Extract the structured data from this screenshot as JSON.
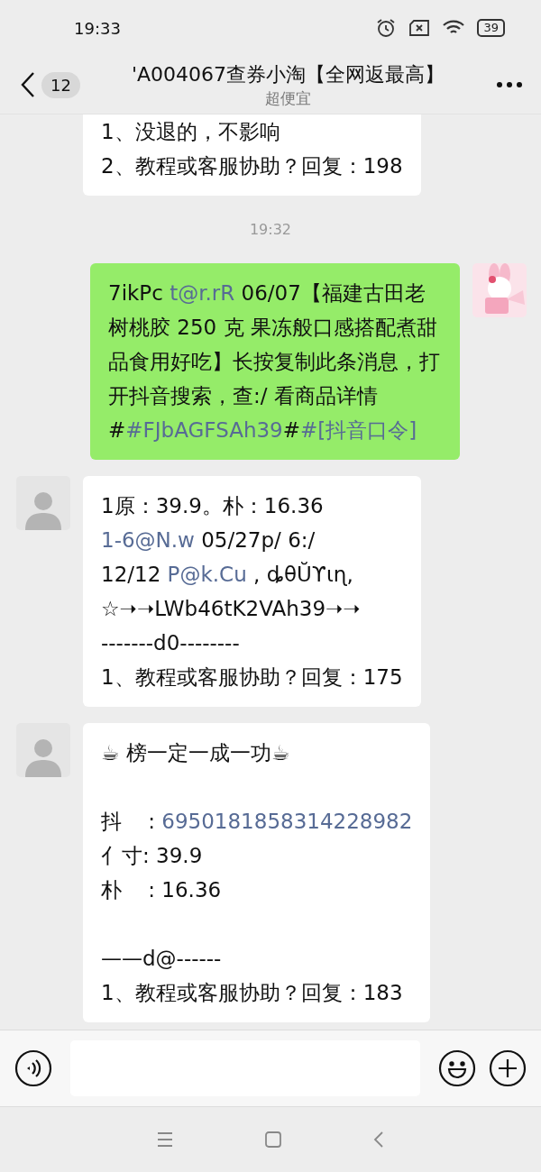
{
  "status_bar": {
    "time": "19:33",
    "battery": "39"
  },
  "header": {
    "back_count": "12",
    "title": "'A004067查券小淘【全网返最高】",
    "subtitle": "超便宜"
  },
  "messages": [
    {
      "kind": "incoming",
      "cut_top": true,
      "lines": [
        {
          "kind": "text",
          "segments": [
            {
              "text": "1、没退的，不影响",
              "link": false
            }
          ]
        },
        {
          "kind": "text",
          "segments": [
            {
              "text": "2、教程或客服协助？回复：198",
              "link": false
            }
          ]
        }
      ]
    },
    {
      "kind": "time",
      "text": "19:32"
    },
    {
      "kind": "outgoing",
      "cut_top": false,
      "lines": [
        {
          "kind": "text",
          "segments": [
            {
              "text": "7ikPc ",
              "link": false
            },
            {
              "text": "t@r.rR",
              "link": true
            },
            {
              "text": " 06/07【福建古田老树桃胶 250 克 果冻般口感搭配煮甜品食用好吃】长按复制此条消息，打开抖音搜索，查:/ 看商品详情#",
              "link": false
            },
            {
              "text": "#FJbAGFSAh39",
              "link": true
            },
            {
              "text": "#",
              "link": false
            },
            {
              "text": "#[抖音口令]",
              "link": true
            }
          ]
        }
      ]
    },
    {
      "kind": "incoming",
      "cut_top": false,
      "lines": [
        {
          "kind": "text",
          "segments": [
            {
              "text": "1原：39.9。朴：16.36",
              "link": false
            }
          ]
        },
        {
          "kind": "text",
          "segments": [
            {
              "text": "1-6@N.w",
              "link": true
            },
            {
              "text": " 05/27p/ 6:/",
              "link": false
            }
          ]
        },
        {
          "kind": "text",
          "segments": [
            {
              "text": "12/12 ",
              "link": false
            },
            {
              "text": "P@k.Cu",
              "link": true
            },
            {
              "text": " , ȡθŬϒɩɳ,",
              "link": false
            }
          ]
        },
        {
          "kind": "text",
          "segments": [
            {
              "text": "☆➝➝LWb46tK2VAh39➝➝",
              "link": false
            }
          ]
        },
        {
          "kind": "text",
          "segments": [
            {
              "text": "-------d0--------",
              "link": false
            }
          ]
        },
        {
          "kind": "text",
          "segments": [
            {
              "text": "1、教程或客服协助？回复：175",
              "link": false
            }
          ]
        }
      ]
    },
    {
      "kind": "incoming",
      "cut_top": false,
      "lines": [
        {
          "kind": "text",
          "segments": [
            {
              "text": "☕ 榜一定一成一功☕",
              "link": false
            }
          ]
        },
        {
          "kind": "blank"
        },
        {
          "kind": "text",
          "segments": [
            {
              "text": "抖    : ",
              "link": false
            },
            {
              "text": "6950181858314228982",
              "link": true
            }
          ]
        },
        {
          "kind": "text",
          "segments": [
            {
              "text": "亻寸: 39.9",
              "link": false
            }
          ]
        },
        {
          "kind": "text",
          "segments": [
            {
              "text": "朴    : 16.36",
              "link": false
            }
          ]
        },
        {
          "kind": "blank"
        },
        {
          "kind": "text",
          "segments": [
            {
              "text": "——d@------",
              "link": false
            }
          ]
        },
        {
          "kind": "text",
          "segments": [
            {
              "text": "1、教程或客服协助？回复：183",
              "link": false
            }
          ]
        }
      ]
    }
  ]
}
